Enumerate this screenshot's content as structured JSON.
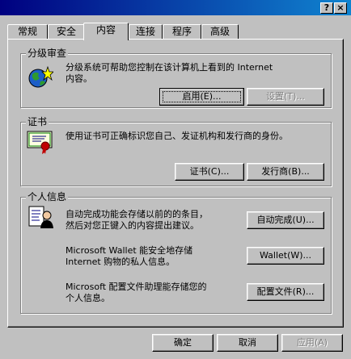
{
  "window": {
    "help_button": "?",
    "close_button": "×"
  },
  "tabs": [
    "常规",
    "安全",
    "内容",
    "连接",
    "程序",
    "高级"
  ],
  "content_advisor": {
    "title": "分级审查",
    "description": "分级系统可帮助您控制在该计算机上看到的 Internet\n内容。",
    "enable_button": "启用(E)...",
    "settings_button": "设置(T)..."
  },
  "certificates": {
    "title": "证书",
    "description": "使用证书可正确标识您自己、发证机构和发行商的身份。",
    "certificates_button": "证书(C)...",
    "publishers_button": "发行商(B)..."
  },
  "personal_info": {
    "title": "个人信息",
    "autocomplete_text": "自动完成功能会存储以前的的条目，\n然后对您正键入的内容提出建议。",
    "autocomplete_button": "自动完成(U)...",
    "wallet_text": "Microsoft Wallet 能安全地存储\nInternet 购物的私人信息。",
    "wallet_button": "Wallet(W)...",
    "profile_text": "Microsoft 配置文件助理能存储您的\n个人信息。",
    "profile_button": "配置文件(R)..."
  },
  "footer": {
    "ok_button": "确定",
    "cancel_button": "取消",
    "apply_button": "应用(A)"
  }
}
